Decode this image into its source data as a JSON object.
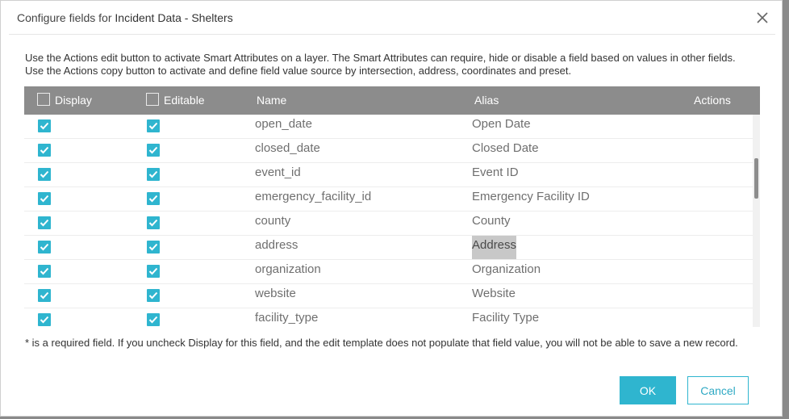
{
  "dialog": {
    "title_prefix": "Configure fields for ",
    "title_layer": "Incident Data - Shelters",
    "description": "Use the Actions edit button to activate Smart Attributes on a layer. The Smart Attributes can require, hide or disable a field based on values in other fields. Use the Actions copy button to activate and define field value source by intersection, address, coordinates and preset.",
    "footnote": "* is a required field. If you uncheck Display for this field, and the edit template does not populate that field value, you will not be able to save a new record.",
    "ok_label": "OK",
    "cancel_label": "Cancel",
    "close_icon": "close-icon"
  },
  "table": {
    "headers": {
      "display": "Display",
      "editable": "Editable",
      "name": "Name",
      "alias": "Alias",
      "actions": "Actions"
    },
    "rows": [
      {
        "name": "open_date",
        "alias": "Open Date",
        "display": true,
        "editable": true,
        "selected": false
      },
      {
        "name": "closed_date",
        "alias": "Closed Date",
        "display": true,
        "editable": true,
        "selected": false
      },
      {
        "name": "event_id",
        "alias": "Event ID",
        "display": true,
        "editable": true,
        "selected": false
      },
      {
        "name": "emergency_facility_id",
        "alias": "Emergency Facility ID",
        "display": true,
        "editable": true,
        "selected": false
      },
      {
        "name": "county",
        "alias": "County",
        "display": true,
        "editable": true,
        "selected": false
      },
      {
        "name": "address",
        "alias": "Address",
        "display": true,
        "editable": true,
        "selected": true
      },
      {
        "name": "organization",
        "alias": "Organization",
        "display": true,
        "editable": true,
        "selected": false
      },
      {
        "name": "website",
        "alias": "Website",
        "display": true,
        "editable": true,
        "selected": false
      },
      {
        "name": "facility_type",
        "alias": "Facility Type",
        "display": true,
        "editable": true,
        "selected": false
      }
    ]
  },
  "colors": {
    "accent": "#2fb5cf",
    "header_bg": "#8c8c8c",
    "selected_bg": "#c8c8c8"
  }
}
